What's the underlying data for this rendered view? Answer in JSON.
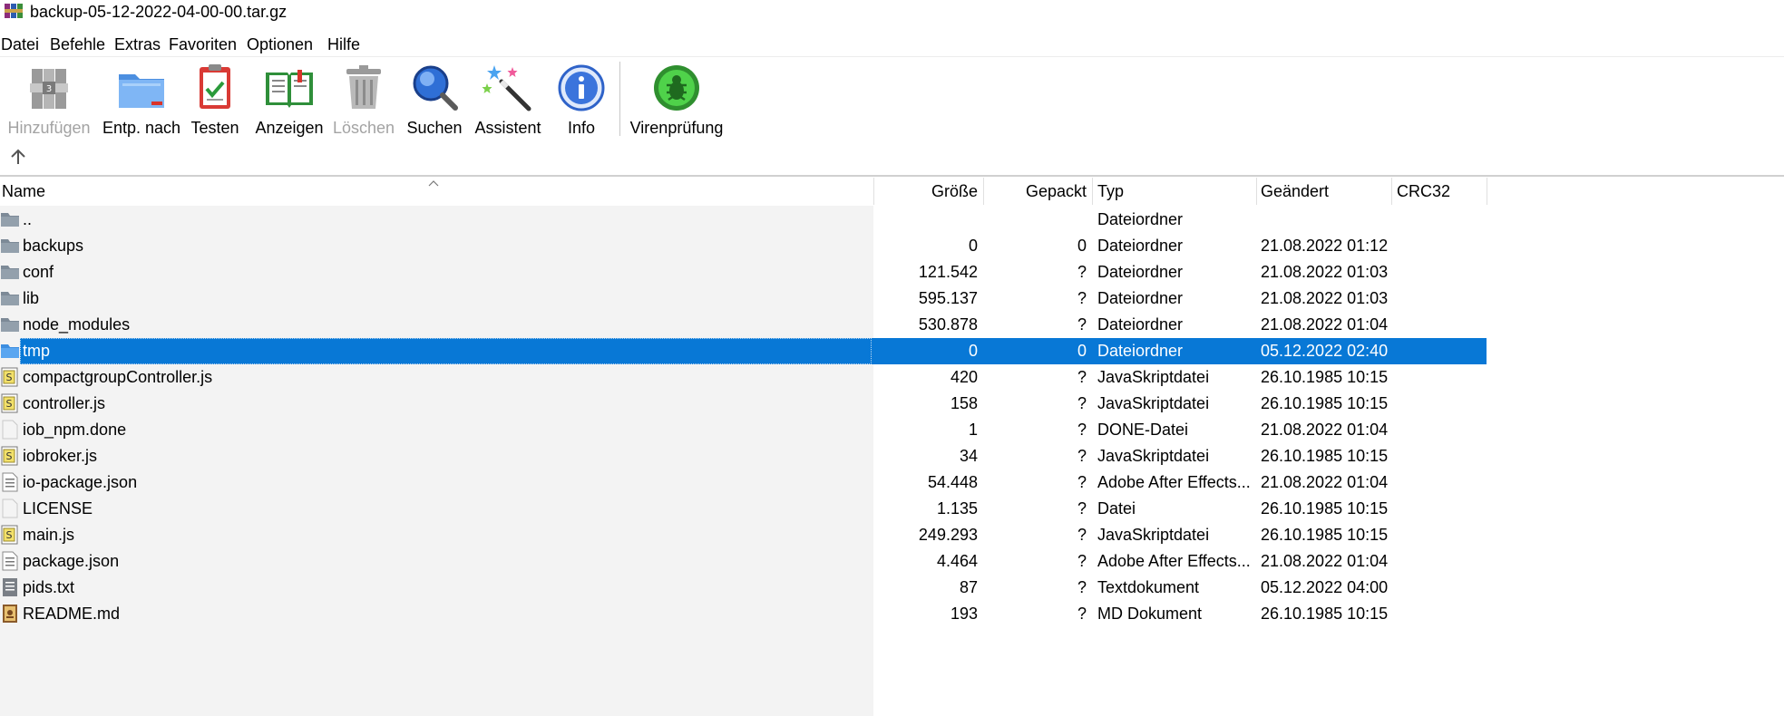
{
  "window": {
    "title": "backup-05-12-2022-04-00-00.tar.gz"
  },
  "menu": [
    "Datei",
    "Befehle",
    "Extras",
    "Favoriten",
    "Optionen",
    "Hilfe"
  ],
  "toolbar": [
    {
      "label": "Hinzufügen",
      "icon": "add-archive-icon",
      "enabled": false
    },
    {
      "label": "Entp. nach",
      "icon": "extract-folder-icon",
      "enabled": true
    },
    {
      "label": "Testen",
      "icon": "test-clipboard-icon",
      "enabled": true
    },
    {
      "label": "Anzeigen",
      "icon": "view-book-icon",
      "enabled": true
    },
    {
      "label": "Löschen",
      "icon": "trash-icon",
      "enabled": false
    },
    {
      "label": "Suchen",
      "icon": "search-magnifier-icon",
      "enabled": true
    },
    {
      "label": "Assistent",
      "icon": "wizard-wand-icon",
      "enabled": true
    },
    {
      "label": "Info",
      "icon": "info-icon",
      "enabled": true
    },
    {
      "label": "Virenprüfung",
      "icon": "virus-scan-icon",
      "enabled": true
    }
  ],
  "columns": {
    "name": "Name",
    "size": "Größe",
    "packed": "Gepackt",
    "type": "Typ",
    "modified": "Geändert",
    "crc": "CRC32"
  },
  "colors": {
    "selection": "#0878d6",
    "folder": "#7d8a97",
    "folder_selected": "#3d8ee0",
    "disabled_text": "#a3a3a3"
  },
  "files": [
    {
      "name": "..",
      "size": "",
      "packed": "",
      "type": "Dateiordner",
      "modified": "",
      "icon": "folder-icon",
      "selected": false
    },
    {
      "name": "backups",
      "size": "0",
      "packed": "0",
      "type": "Dateiordner",
      "modified": "21.08.2022 01:12",
      "icon": "folder-icon",
      "selected": false
    },
    {
      "name": "conf",
      "size": "121.542",
      "packed": "?",
      "type": "Dateiordner",
      "modified": "21.08.2022 01:03",
      "icon": "folder-icon",
      "selected": false
    },
    {
      "name": "lib",
      "size": "595.137",
      "packed": "?",
      "type": "Dateiordner",
      "modified": "21.08.2022 01:03",
      "icon": "folder-icon",
      "selected": false
    },
    {
      "name": "node_modules",
      "size": "530.878",
      "packed": "?",
      "type": "Dateiordner",
      "modified": "21.08.2022 01:04",
      "icon": "folder-icon",
      "selected": false
    },
    {
      "name": "tmp",
      "size": "0",
      "packed": "0",
      "type": "Dateiordner",
      "modified": "05.12.2022 02:40",
      "icon": "folder-icon",
      "selected": true
    },
    {
      "name": "compactgroupController.js",
      "size": "420",
      "packed": "?",
      "type": "JavaSkriptdatei",
      "modified": "26.10.1985 10:15",
      "icon": "javascript-file-icon",
      "selected": false
    },
    {
      "name": "controller.js",
      "size": "158",
      "packed": "?",
      "type": "JavaSkriptdatei",
      "modified": "26.10.1985 10:15",
      "icon": "javascript-file-icon",
      "selected": false
    },
    {
      "name": "iob_npm.done",
      "size": "1",
      "packed": "?",
      "type": "DONE-Datei",
      "modified": "21.08.2022 01:04",
      "icon": "blank-file-icon",
      "selected": false
    },
    {
      "name": "iobroker.js",
      "size": "34",
      "packed": "?",
      "type": "JavaSkriptdatei",
      "modified": "26.10.1985 10:15",
      "icon": "javascript-file-icon",
      "selected": false
    },
    {
      "name": "io-package.json",
      "size": "54.448",
      "packed": "?",
      "type": "Adobe After Effects...",
      "modified": "21.08.2022 01:04",
      "icon": "json-file-icon",
      "selected": false
    },
    {
      "name": "LICENSE",
      "size": "1.135",
      "packed": "?",
      "type": "Datei",
      "modified": "26.10.1985 10:15",
      "icon": "blank-file-icon",
      "selected": false
    },
    {
      "name": "main.js",
      "size": "249.293",
      "packed": "?",
      "type": "JavaSkriptdatei",
      "modified": "26.10.1985 10:15",
      "icon": "javascript-file-icon",
      "selected": false
    },
    {
      "name": "package.json",
      "size": "4.464",
      "packed": "?",
      "type": "Adobe After Effects...",
      "modified": "21.08.2022 01:04",
      "icon": "json-file-icon",
      "selected": false
    },
    {
      "name": "pids.txt",
      "size": "87",
      "packed": "?",
      "type": "Textdokument",
      "modified": "05.12.2022 04:00",
      "icon": "text-file-icon",
      "selected": false
    },
    {
      "name": "README.md",
      "size": "193",
      "packed": "?",
      "type": "MD Dokument",
      "modified": "26.10.1985 10:15",
      "icon": "markdown-file-icon",
      "selected": false
    }
  ]
}
